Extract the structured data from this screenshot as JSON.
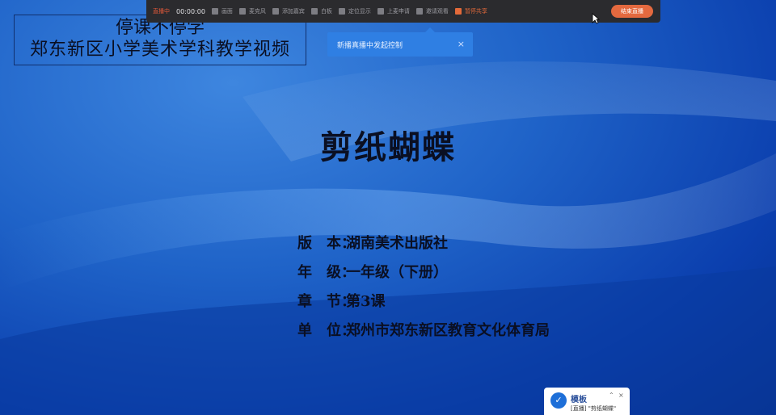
{
  "slide": {
    "header_line1": "停课不停学",
    "header_line2": "郑东新区小学美术学科教学视频",
    "title": "剪纸蝴蝶",
    "info": [
      {
        "key": "版　本：",
        "value": "湖南美术出版社"
      },
      {
        "key": "年　级：",
        "value": "一年级（下册）"
      },
      {
        "key": "章　节：",
        "value": "第3课"
      },
      {
        "key": "单　位：",
        "value": "郑州市郑东新区教育文化体育局"
      }
    ]
  },
  "toolbar": {
    "status": "直播中",
    "time": "00:00:00",
    "items": [
      "画面",
      "麦克风",
      "添加嘉宾",
      "白板",
      "定位显示",
      "上麦申请",
      "邀请观看"
    ],
    "share": "暂停共享",
    "end": "结束直播"
  },
  "popup": {
    "message": "新播真播中发起控制",
    "close": "×"
  },
  "mini_window": {
    "logo": "✓",
    "name": "模板",
    "subtitle": "[直播] \"剪纸蝴蝶\"",
    "pin": "⌃",
    "close": "×"
  },
  "colors": {
    "accent": "#e4693f",
    "toolbar_bg": "#2b2b2e",
    "popup_bg": "#2f7fe3",
    "slide_blue": "#1f63c8"
  }
}
